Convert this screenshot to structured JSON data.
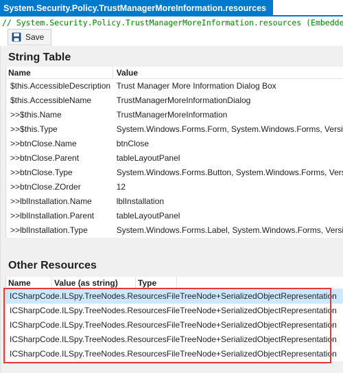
{
  "tab": {
    "title": "System.Security.Policy.TrustManagerMoreInformation.resources"
  },
  "code_line": "// System.Security.Policy.TrustManagerMoreInformation.resources (Embedded, Public)",
  "toolbar": {
    "save_label": "Save"
  },
  "string_table": {
    "title": "String Table",
    "columns": [
      "Name",
      "Value"
    ],
    "rows": [
      {
        "name": "$this.AccessibleDescription",
        "value": "Trust Manager More Information Dialog Box"
      },
      {
        "name": "$this.AccessibleName",
        "value": "TrustManagerMoreInformationDialog"
      },
      {
        "name": ">>$this.Name",
        "value": "TrustManagerMoreInformation"
      },
      {
        "name": ">>$this.Type",
        "value": "System.Windows.Forms.Form, System.Windows.Forms, Version"
      },
      {
        "name": ">>btnClose.Name",
        "value": "btnClose"
      },
      {
        "name": ">>btnClose.Parent",
        "value": "tableLayoutPanel"
      },
      {
        "name": ">>btnClose.Type",
        "value": "System.Windows.Forms.Button, System.Windows.Forms, Versic"
      },
      {
        "name": ">>btnClose.ZOrder",
        "value": "12"
      },
      {
        "name": ">>lblInstallation.Name",
        "value": "lblInstallation"
      },
      {
        "name": ">>lblInstallation.Parent",
        "value": "tableLayoutPanel"
      },
      {
        "name": ">>lblInstallation.Type",
        "value": "System.Windows.Forms.Label, System.Windows.Forms, Version"
      }
    ]
  },
  "other_resources": {
    "title": "Other Resources",
    "columns": [
      "Name",
      "Value (as string)",
      "Type"
    ],
    "rows": [
      "ICSharpCode.ILSpy.TreeNodes.ResourcesFileTreeNode+SerializedObjectRepresentation",
      "ICSharpCode.ILSpy.TreeNodes.ResourcesFileTreeNode+SerializedObjectRepresentation",
      "ICSharpCode.ILSpy.TreeNodes.ResourcesFileTreeNode+SerializedObjectRepresentation",
      "ICSharpCode.ILSpy.TreeNodes.ResourcesFileTreeNode+SerializedObjectRepresentation",
      "ICSharpCode.ILSpy.TreeNodes.ResourcesFileTreeNode+SerializedObjectRepresentation"
    ]
  },
  "colors": {
    "accent": "#007acc",
    "selection": "#cce8ff",
    "highlight": "#e53935",
    "comment": "#008000"
  }
}
